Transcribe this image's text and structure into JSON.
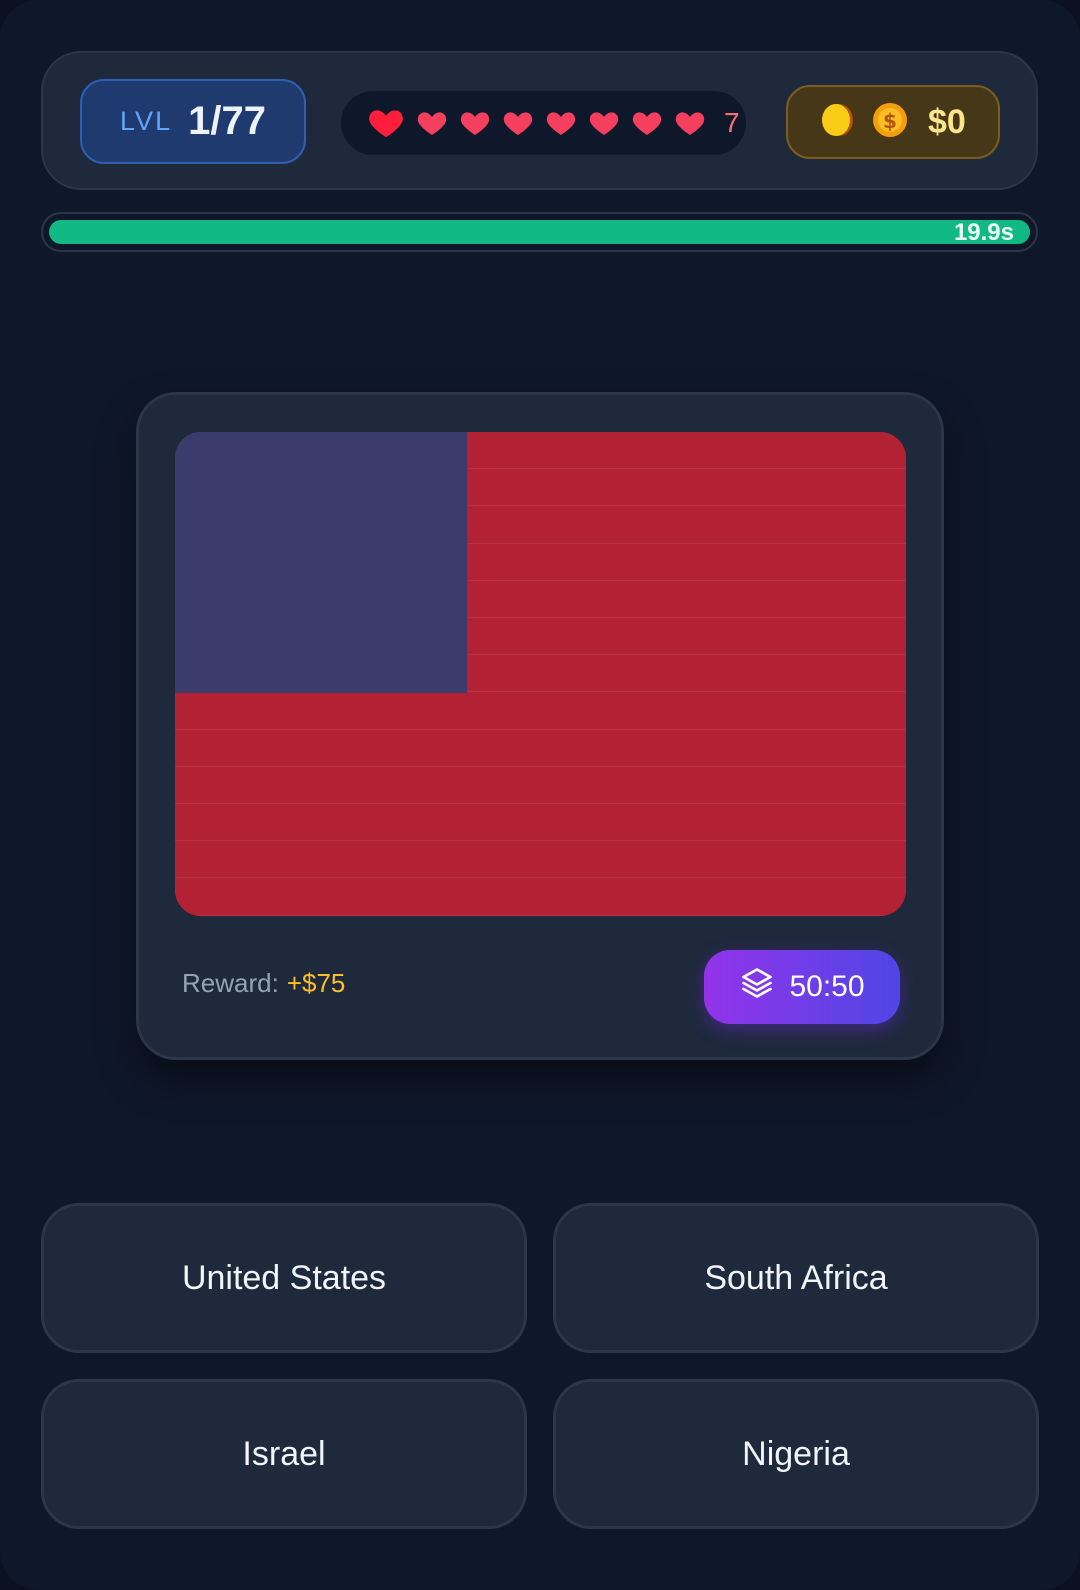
{
  "header": {
    "level_label": "LVL",
    "level_value": "1/77",
    "lives": {
      "hearts_shown": 8,
      "count": "7"
    },
    "money": "$0"
  },
  "timer": {
    "text": "19.9s",
    "remaining_fraction": 1.0,
    "color": "#10b981"
  },
  "question": {
    "flag": {
      "colors": {
        "field": "#b22234",
        "canton": "#3c3b6e"
      }
    },
    "reward_label": "Reward:",
    "reward_value": "+$75",
    "lifeline_label": "50:50"
  },
  "answers": [
    {
      "label": "United States"
    },
    {
      "label": "South Africa"
    },
    {
      "label": "Israel"
    },
    {
      "label": "Nigeria"
    }
  ]
}
